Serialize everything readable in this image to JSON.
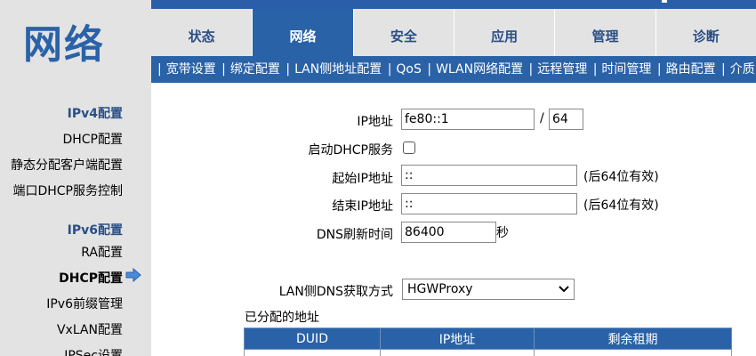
{
  "brand": {
    "title": "网络"
  },
  "tabs": [
    {
      "label": "状态",
      "active": false
    },
    {
      "label": "网络",
      "active": true
    },
    {
      "label": "安全",
      "active": false
    },
    {
      "label": "应用",
      "active": false
    },
    {
      "label": "管理",
      "active": false
    },
    {
      "label": "诊断",
      "active": false
    }
  ],
  "subnav": {
    "items": [
      "宽带设置",
      "绑定配置",
      "LAN侧地址配置",
      "QoS",
      "WLAN网络配置",
      "远程管理",
      "时间管理",
      "路由配置",
      "介质"
    ]
  },
  "sidebar": {
    "ipv4_header": "IPv4配置",
    "ipv4_items": [
      "DHCP配置",
      "静态分配客户端配置",
      "端口DHCP服务控制"
    ],
    "ipv6_header": "IPv6配置",
    "ipv6_items": [
      "RA配置",
      "DHCP配置",
      "IPv6前缀管理",
      "VxLAN配置",
      "IPSec设置"
    ],
    "current": "DHCP配置"
  },
  "form": {
    "ip_label": "IP地址",
    "ip_value": "fe80::1",
    "slash": "/",
    "prefix_value": "64",
    "dhcp_label": "启动DHCP服务",
    "dhcp_checked": false,
    "start_label": "起始IP地址",
    "start_value": "::",
    "start_hint": "(后64位有效)",
    "end_label": "结束IP地址",
    "end_value": "::",
    "end_hint": "(后64位有效)",
    "dns_refresh_label": "DNS刷新时间",
    "dns_refresh_value": "86400",
    "dns_refresh_unit": "秒",
    "lan_dns_label": "LAN侧DNS获取方式",
    "lan_dns_value": "HGWProxy"
  },
  "assigned": {
    "title": "已分配的地址",
    "columns": [
      "DUID",
      "IP地址",
      "剩余租期"
    ]
  },
  "colors": {
    "accent": "#2a62a8",
    "sidebar_bg": "#e3e3e3",
    "tab_text": "#2a4f86"
  }
}
